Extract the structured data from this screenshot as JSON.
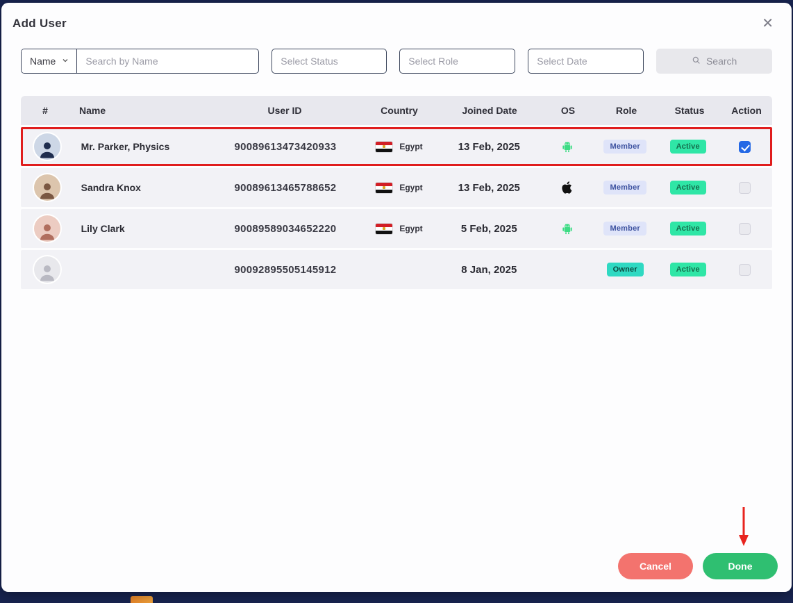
{
  "modal": {
    "title": "Add User",
    "close_label": "✕"
  },
  "filters": {
    "field_dropdown": {
      "value": "Name"
    },
    "name_search": {
      "placeholder": "Search by Name"
    },
    "status": {
      "placeholder": "Select Status"
    },
    "role": {
      "placeholder": "Select Role"
    },
    "date": {
      "placeholder": "Select Date"
    },
    "search_button_label": "Search"
  },
  "table": {
    "headers": [
      "#",
      "Name",
      "User ID",
      "Country",
      "Joined Date",
      "OS",
      "Role",
      "Status",
      "Action"
    ],
    "rows": [
      {
        "name": "Mr. Parker, Physics",
        "user_id": "90089613473420933",
        "country": "Egypt",
        "joined_date": "13 Feb, 2025",
        "os": "android",
        "role": "Member",
        "status": "Active",
        "selected": true,
        "highlighted": true
      },
      {
        "name": "Sandra Knox",
        "user_id": "90089613465788652",
        "country": "Egypt",
        "joined_date": "13 Feb, 2025",
        "os": "apple",
        "role": "Member",
        "status": "Active",
        "selected": false,
        "highlighted": false
      },
      {
        "name": "Lily Clark",
        "user_id": "90089589034652220",
        "country": "Egypt",
        "joined_date": "5 Feb, 2025",
        "os": "android",
        "role": "Member",
        "status": "Active",
        "selected": false,
        "highlighted": false
      },
      {
        "name": "",
        "user_id": "90092895505145912",
        "country": "",
        "joined_date": "8 Jan, 2025",
        "os": "",
        "role": "Owner",
        "status": "Active",
        "selected": false,
        "highlighted": false
      }
    ]
  },
  "footer": {
    "cancel_label": "Cancel",
    "done_label": "Done"
  },
  "colors": {
    "highlight_border": "#e01d1d",
    "arrow_red": "#e8241f",
    "member_badge_bg": "#dfe4f9",
    "owner_badge_bg": "#2fd9c2",
    "active_badge_bg": "#2fe6a6",
    "cancel_button_bg": "#f3736e",
    "done_button_bg": "#2fbf71",
    "checkbox_checked": "#2468e5"
  }
}
